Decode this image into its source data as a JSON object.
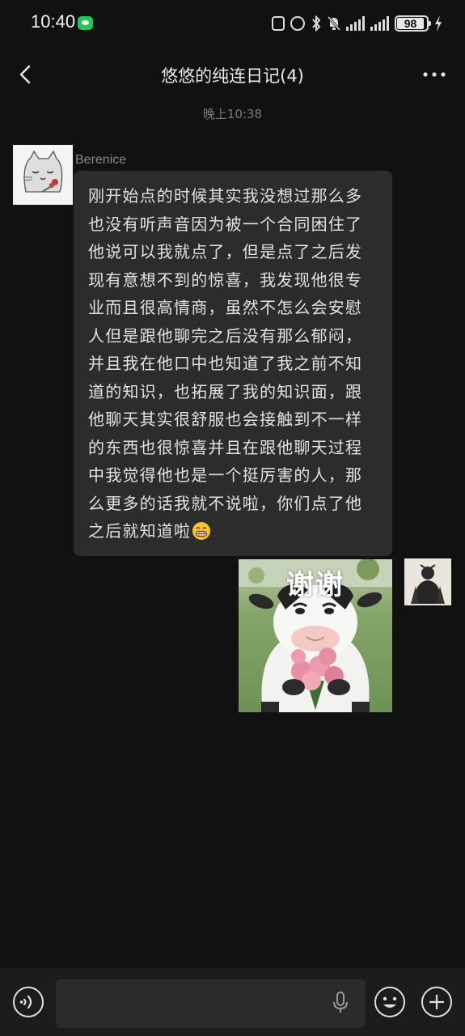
{
  "status_bar": {
    "time": "10:40",
    "battery_level": "98",
    "icons": [
      "wechat-notification-icon",
      "nfc-icon",
      "alarm-icon",
      "bluetooth-icon",
      "mute-icon",
      "signal-icon",
      "signal-icon",
      "battery-icon",
      "charging-icon"
    ]
  },
  "header": {
    "title": "悠悠的纯连日记(4)",
    "back_icon": "chevron-left-icon",
    "more_icon": "more-dots-icon"
  },
  "chat": {
    "timestamp": "晚上10:38",
    "messages": [
      {
        "direction": "incoming",
        "sender": "Berenice",
        "text": "刚开始点的时候其实我没想过那么多也没有听声音因为被一个合同困住了他说可以我就点了，但是点了之后发现有意想不到的惊喜，我发现他很专业而且很高情商，虽然不怎么会安慰人但是跟他聊完之后没有那么郁闷，并且我在他口中也知道了我之前不知道的知识，也拓展了我的知识面，跟他聊天其实很舒服也会接触到不一样的东西也很惊喜并且在跟他聊天过程中我觉得他也是一个挺厉害的人，那么更多的话我就不说啦，你们点了他之后就知道啦",
        "emoji": "grinning-face-emoji"
      },
      {
        "direction": "outgoing",
        "type": "sticker",
        "sticker_caption": "谢谢"
      }
    ]
  },
  "input_bar": {
    "placeholder": "",
    "voice_icon": "voice-input-icon",
    "mic_icon": "microphone-icon",
    "emoji_icon": "emoji-icon",
    "plus_icon": "plus-icon"
  },
  "colors": {
    "background": "#111111",
    "bubble_incoming": "#2c2c2c",
    "input_bar": "#1c1c1c",
    "wechat_green": "#2ac25b"
  }
}
